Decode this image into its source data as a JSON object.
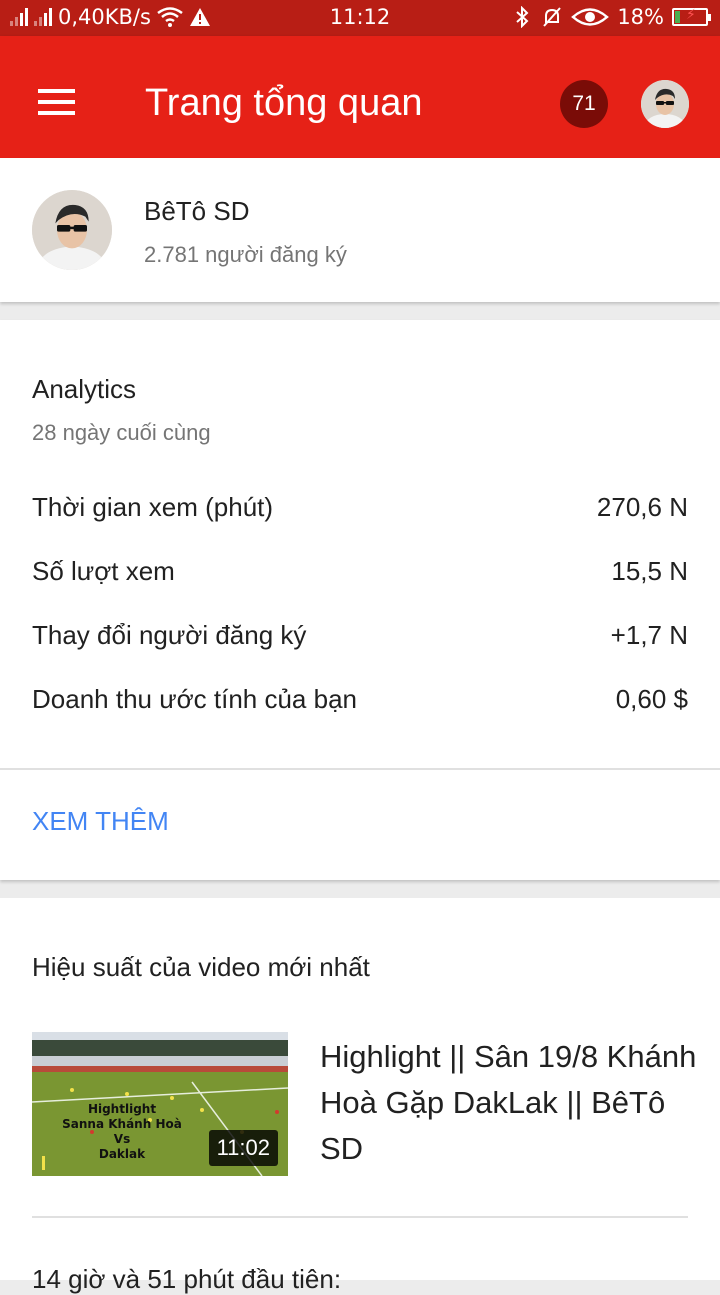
{
  "status_bar": {
    "network_speed": "0,40KB/s",
    "time": "11:12",
    "battery_percent": "18%",
    "battery_level": 0.18
  },
  "app_bar": {
    "title": "Trang tổng quan",
    "notification_count": "71"
  },
  "channel": {
    "name": "BêTô SD",
    "subscribers": "2.781 người đăng ký"
  },
  "analytics": {
    "heading": "Analytics",
    "period": "28 ngày cuối cùng",
    "metrics": [
      {
        "label": "Thời gian xem (phút)",
        "value": "270,6 N"
      },
      {
        "label": "Số lượt xem",
        "value": "15,5 N"
      },
      {
        "label": "Thay đổi người đăng ký",
        "value": "+1,7 N"
      },
      {
        "label": "Doanh thu ước tính của bạn",
        "value": "0,60 $"
      }
    ],
    "see_more": "XEM THÊM"
  },
  "latest_video": {
    "heading": "Hiệu suất của video mới nhất",
    "title": "Highlight || Sân 19/8 Khánh Hoà Gặp DakLak || BêTô SD",
    "duration": "11:02",
    "thumbnail_text": [
      "Hightlight",
      "Sanna Khánh Hoà",
      "Vs",
      "Daklak"
    ],
    "since_publish": "14 giờ và 51 phút đầu tiên:"
  },
  "colors": {
    "app_bar": "#e62117",
    "status_bar": "#b81e15",
    "notification_badge": "#7a0c07",
    "link": "#4285f4"
  },
  "icons": [
    "signal-icon",
    "wifi-icon",
    "warning-icon",
    "bluetooth-icon",
    "mute-bell-icon",
    "eye-icon",
    "battery-icon",
    "menu-icon"
  ]
}
